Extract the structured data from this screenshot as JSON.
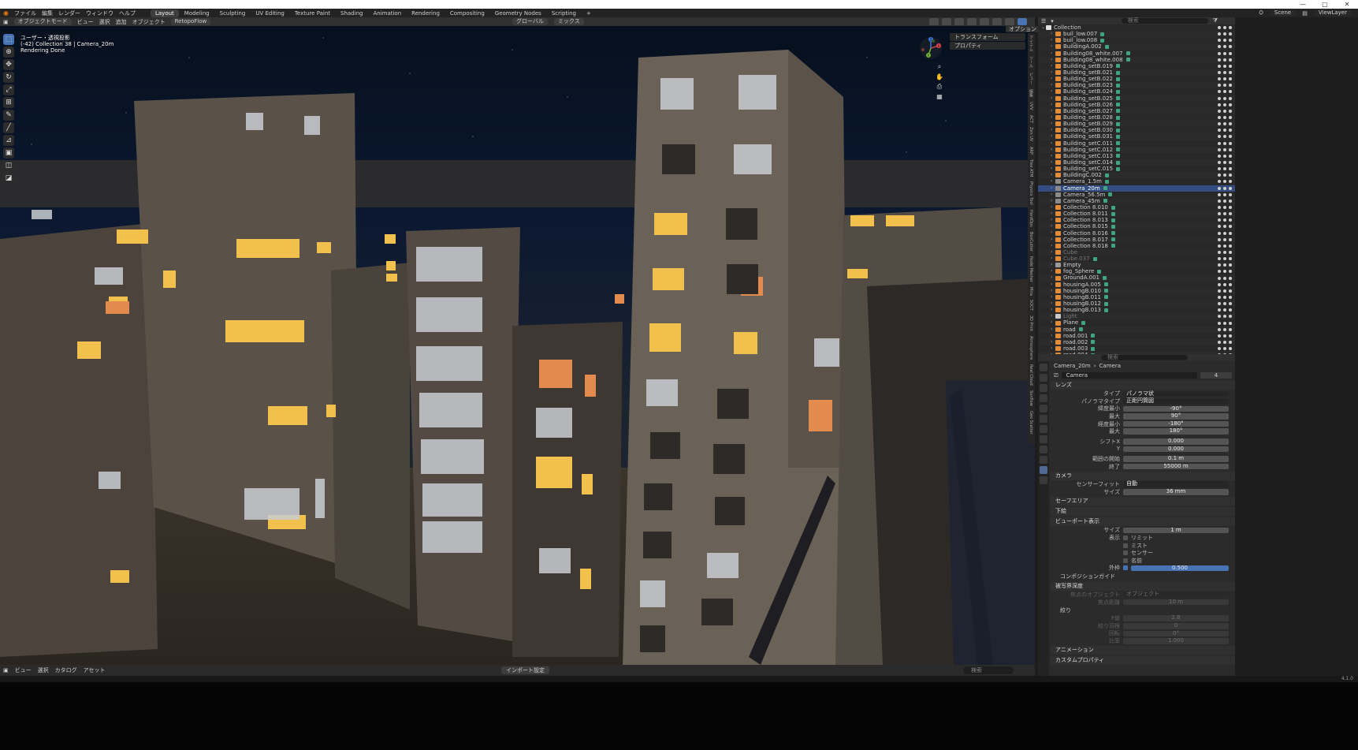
{
  "titlebar": {
    "minimize": "—",
    "maximize": "□",
    "close": "✕"
  },
  "menubar": {
    "menus": [
      "ファイル",
      "編集",
      "レンダー",
      "ウィンドウ",
      "ヘルプ"
    ],
    "workspaces": [
      "Layout",
      "Modeling",
      "Sculpting",
      "UV Editing",
      "Texture Paint",
      "Shading",
      "Animation",
      "Rendering",
      "Compositing",
      "Geometry Nodes",
      "Scripting"
    ],
    "active_workspace": "Layout",
    "add_tab": "+",
    "scene": "Scene",
    "view_layer": "ViewLayer"
  },
  "viewport_header": {
    "mode": "オブジェクトモード",
    "menus": [
      "ビュー",
      "選択",
      "追加",
      "オブジェクト"
    ],
    "retopoflow": "RetopoFlow",
    "transform_orientation": "グローバル",
    "snap": "ミックス",
    "options": "オプション"
  },
  "viewport": {
    "info_line1": "ユーザー・透視投影",
    "info_line2": "(-42) Collection 38 | Camera_20m",
    "info_line3": "Rendering Done",
    "npanel_sections": [
      "トランスフォーム",
      "プロパティ"
    ],
    "gizmo_labels": {
      "x": "X",
      "y": "Y",
      "z": "Z"
    },
    "tools": [
      "select",
      "cursor",
      "move",
      "rotate",
      "scale",
      "transform",
      "annotate",
      "measure",
      "add-cube",
      "extrude",
      "edit"
    ],
    "sidebar_tabs": [
      "アイテム",
      "ツール",
      "ビュー",
      "編集",
      "UVV",
      "ACT",
      "Zen UV",
      "ARP",
      "Tree ATM",
      "Physics Tool",
      "HardOps",
      "BoxCutter",
      "Node Mesher",
      "Mira",
      "SOCT",
      "3D Print",
      "Atmosphere",
      "Real Cloud",
      "Sunflow",
      "Geo Scatter"
    ]
  },
  "statusbar": {
    "menus": [
      "ビュー",
      "選択",
      "カタログ",
      "アセット"
    ],
    "import": "インポート設定",
    "search_placeholder": "検索",
    "version": "4.1.0"
  },
  "outliner": {
    "search_placeholder": "検索",
    "items": [
      {
        "name": "Collection",
        "kind": "coll",
        "exp": "⌄"
      },
      {
        "name": "buil_low.007",
        "kind": "obj",
        "badge": true
      },
      {
        "name": "buil_low.008",
        "kind": "obj",
        "badge": true
      },
      {
        "name": "BuildingA.002",
        "kind": "obj",
        "badge": true
      },
      {
        "name": "Building08_white.007",
        "kind": "obj",
        "badge": true
      },
      {
        "name": "Building08_white.008",
        "kind": "obj",
        "badge": true
      },
      {
        "name": "Building_setB.019",
        "kind": "obj",
        "badge": true
      },
      {
        "name": "Building_setB.021",
        "kind": "obj",
        "badge": true
      },
      {
        "name": "Building_setB.022",
        "kind": "obj",
        "badge": true
      },
      {
        "name": "Building_setB.023",
        "kind": "obj",
        "badge": true
      },
      {
        "name": "Building_setB.024",
        "kind": "obj",
        "badge": true
      },
      {
        "name": "Building_setB.025",
        "kind": "obj",
        "badge": true
      },
      {
        "name": "Building_setB.026",
        "kind": "obj",
        "badge": true
      },
      {
        "name": "Building_setB.027",
        "kind": "obj",
        "badge": true
      },
      {
        "name": "Building_setB.028",
        "kind": "obj",
        "badge": true
      },
      {
        "name": "Building_setB.029",
        "kind": "obj",
        "badge": true
      },
      {
        "name": "Building_setB.030",
        "kind": "obj",
        "badge": true
      },
      {
        "name": "Building_setB.031",
        "kind": "obj",
        "badge": true
      },
      {
        "name": "Building_setC.011",
        "kind": "obj",
        "badge": true
      },
      {
        "name": "Building_setC.012",
        "kind": "obj",
        "badge": true
      },
      {
        "name": "Building_setC.013",
        "kind": "obj",
        "badge": true
      },
      {
        "name": "Building_setC.014",
        "kind": "obj",
        "badge": true
      },
      {
        "name": "Building_setC.015",
        "kind": "obj",
        "badge": true
      },
      {
        "name": "BuildingC.002",
        "kind": "obj",
        "badge": true
      },
      {
        "name": "Camera_1.5m",
        "kind": "cam",
        "badge": true
      },
      {
        "name": "Camera_20m",
        "kind": "cam",
        "badge": true,
        "selected": true
      },
      {
        "name": "Camera_56.5m",
        "kind": "cam",
        "badge": true
      },
      {
        "name": "Camera_45m",
        "kind": "cam",
        "badge": true
      },
      {
        "name": "Collection 8.010",
        "kind": "obj",
        "badge": true
      },
      {
        "name": "Collection 8.011",
        "kind": "obj",
        "badge": true
      },
      {
        "name": "Collection 8.013",
        "kind": "obj",
        "badge": true
      },
      {
        "name": "Collection 8.015",
        "kind": "obj",
        "badge": true
      },
      {
        "name": "Collection 8.016",
        "kind": "obj",
        "badge": true
      },
      {
        "name": "Collection 8.017",
        "kind": "obj",
        "badge": true
      },
      {
        "name": "Collection 8.018",
        "kind": "obj",
        "badge": true
      },
      {
        "name": "Cube",
        "kind": "obj",
        "dim": true
      },
      {
        "name": "Cube.037",
        "kind": "obj",
        "dim": true,
        "badge": true
      },
      {
        "name": "Empty",
        "kind": "emp"
      },
      {
        "name": "fog_Sphere",
        "kind": "obj",
        "badge": true
      },
      {
        "name": "GroundA.001",
        "kind": "obj",
        "badge": true
      },
      {
        "name": "housingA.005",
        "kind": "obj",
        "badge": true
      },
      {
        "name": "housingB.010",
        "kind": "obj",
        "badge": true
      },
      {
        "name": "housingB.011",
        "kind": "obj",
        "badge": true
      },
      {
        "name": "housingB.012",
        "kind": "obj",
        "badge": true
      },
      {
        "name": "housingB.013",
        "kind": "obj",
        "badge": true
      },
      {
        "name": "Light",
        "kind": "light",
        "dim": true
      },
      {
        "name": "Plane",
        "kind": "obj",
        "badge": true
      },
      {
        "name": "road",
        "kind": "obj",
        "badge": true
      },
      {
        "name": "road.001",
        "kind": "obj",
        "badge": true
      },
      {
        "name": "road.002",
        "kind": "obj",
        "badge": true
      },
      {
        "name": "road.003",
        "kind": "obj",
        "badge": true
      },
      {
        "name": "road.004",
        "kind": "obj",
        "badge": true
      }
    ]
  },
  "properties": {
    "search_placeholder": "検索",
    "breadcrumb": [
      "Camera_20m",
      "Camera"
    ],
    "datablock": "Camera",
    "datablock_users": "4",
    "lens_panel": "レンズ",
    "type_label": "タイプ",
    "type_value": "パノラマ状",
    "pano_type_label": "パノラマタイプ",
    "pano_type_value": "正距円筒図",
    "lat_min_label": "緯度最小",
    "lat_min_value": "-90°",
    "lat_max_label": "最大",
    "lat_max_value": "90°",
    "lon_min_label": "経度最小",
    "lon_min_value": "-180°",
    "lon_max_label": "最大",
    "lon_max_value": "180°",
    "shift_x_label": "シフトX",
    "shift_x_value": "0.000",
    "shift_y_label": "Y",
    "shift_y_value": "0.000",
    "clip_start_label": "範囲の開始",
    "clip_start_value": "0.1 m",
    "clip_end_label": "終了",
    "clip_end_value": "55000 m",
    "camera_panel": "カメラ",
    "sensor_fit_label": "センサーフィット",
    "sensor_fit_value": "自動",
    "size_label": "サイズ",
    "size_value": "36 mm",
    "safe_areas_panel": "セーフエリア",
    "background_panel": "下絵",
    "viewport_display_panel": "ビューポート表示",
    "vp_size_label": "サイズ",
    "vp_size_value": "1 m",
    "show_label": "表示",
    "show_limits": "リミット",
    "show_mist": "ミスト",
    "show_sensor": "センサー",
    "show_name": "名前",
    "passepartout_label": "外枠",
    "passepartout_value": "0.500",
    "composition_panel": "コンポジションガイド",
    "dof_panel": "被写界深度",
    "focus_object_label": "焦点のオブジェクト",
    "focus_object_value": "オブジェクト",
    "focus_distance_label": "焦点距離",
    "focus_distance_value": "10 m",
    "aperture_subpanel": "絞り",
    "fstop_label": "F値",
    "fstop_value": "2.8",
    "blades_label": "絞り羽根",
    "blades_value": "0",
    "rotation_label": "回転",
    "rotation_value": "0°",
    "ratio_label": "比率",
    "ratio_value": "1.000",
    "animation_panel": "アニメーション",
    "custom_props_panel": "カスタムプロパティ"
  },
  "colors": {
    "accent": "#4772b3",
    "selected_row": "#334d80",
    "object_icon": "#e48b35",
    "brand": "#e87d0d"
  }
}
